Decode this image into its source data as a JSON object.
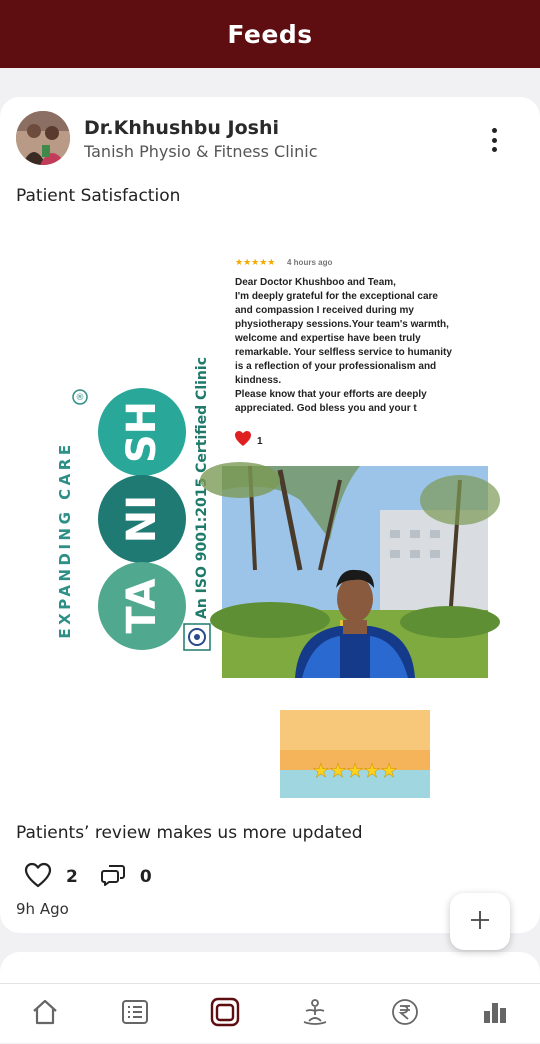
{
  "header": {
    "title": "Feeds"
  },
  "post": {
    "author": "Dr.Khhushbu Joshi",
    "clinic": "Tanish Physio & Fitness Clinic",
    "title": "Patient Satisfaction",
    "image": {
      "logo_vertical_text": "EXPANDING CARE",
      "logo_letters": [
        "SH",
        "NI",
        "TA"
      ],
      "registered_mark": "®",
      "iso_text": "An ISO 9001:2015 Certified Clinic",
      "review": {
        "stars": "★★★★★",
        "time": "4 hours ago",
        "lines": [
          "Dear Doctor Khushboo and Team,",
          "I'm deeply grateful for the exceptional care",
          "and compassion I received during my",
          "physiotherapy sessions.Your team's warmth,",
          "welcome and expertise have been truly",
          "remarkable. Your selfless service to humanity",
          "is a reflection of your professionalism and",
          "kindness.",
          "Please know that your efforts are deeply",
          "appreciated. God bless you and your t"
        ],
        "reaction_count": "1"
      },
      "rating_stars": "★★★★★"
    },
    "caption": "Patients’ review makes us more updated",
    "likes": "2",
    "comments": "0",
    "time": "9h Ago"
  },
  "colors": {
    "header_bg": "#5e0d10",
    "logo_teal": "#2e9a8a"
  },
  "fab": {
    "icon": "plus-icon"
  },
  "nav": {
    "items": [
      "home-icon",
      "list-icon",
      "feeds-icon",
      "yoga-icon",
      "rupee-icon",
      "bar-chart-icon"
    ],
    "active": "feeds-icon"
  }
}
